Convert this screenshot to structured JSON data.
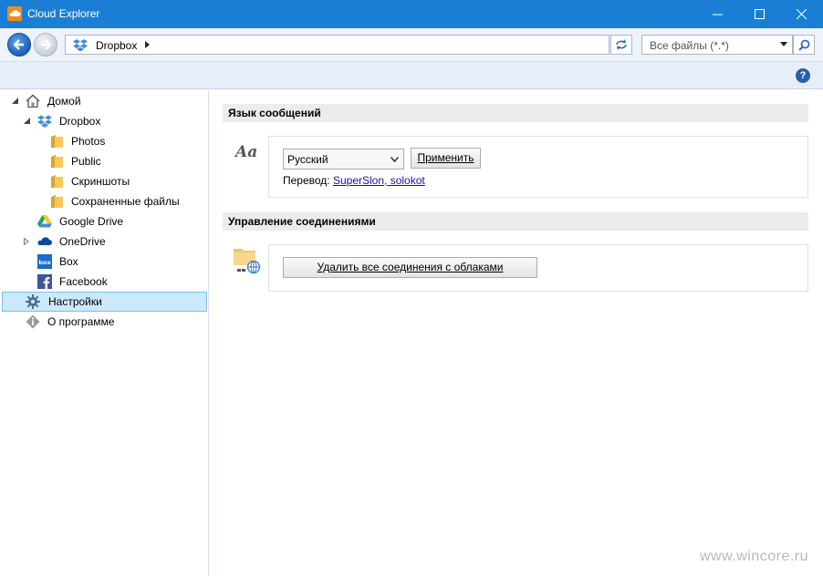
{
  "window": {
    "title": "Cloud Explorer"
  },
  "addressbar": {
    "path": "Dropbox",
    "filter": "Все файлы (*.*)"
  },
  "sidebar": {
    "items": [
      {
        "label": "Домой",
        "icon": "home-icon"
      },
      {
        "label": "Dropbox",
        "icon": "dropbox-icon"
      },
      {
        "label": "Photos",
        "icon": "folder-icon"
      },
      {
        "label": "Public",
        "icon": "folder-icon"
      },
      {
        "label": "Скриншоты",
        "icon": "folder-icon"
      },
      {
        "label": "Сохраненные файлы",
        "icon": "folder-icon"
      },
      {
        "label": "Google Drive",
        "icon": "google-drive-icon"
      },
      {
        "label": "OneDrive",
        "icon": "onedrive-icon"
      },
      {
        "label": "Box",
        "icon": "box-icon"
      },
      {
        "label": "Facebook",
        "icon": "facebook-icon"
      },
      {
        "label": "Настройки",
        "icon": "gear-icon"
      },
      {
        "label": "О программе",
        "icon": "info-icon"
      }
    ],
    "selected": "Настройки"
  },
  "main": {
    "language_section": {
      "title": "Язык сообщений",
      "aa_glyph": "Aa",
      "language_value": "Русский",
      "apply_label": "Применить",
      "translation_prefix": "Перевод:",
      "translation_link": "SuperSlon, solokot"
    },
    "connections_section": {
      "title": "Управление соединениями",
      "delete_all_label": "Удалить все соединения с облаками"
    }
  },
  "watermark": "www.wincore.ru",
  "colors": {
    "titlebar": "#1a7fd4",
    "selection": "#cce8fb",
    "link": "#1a0dab"
  }
}
